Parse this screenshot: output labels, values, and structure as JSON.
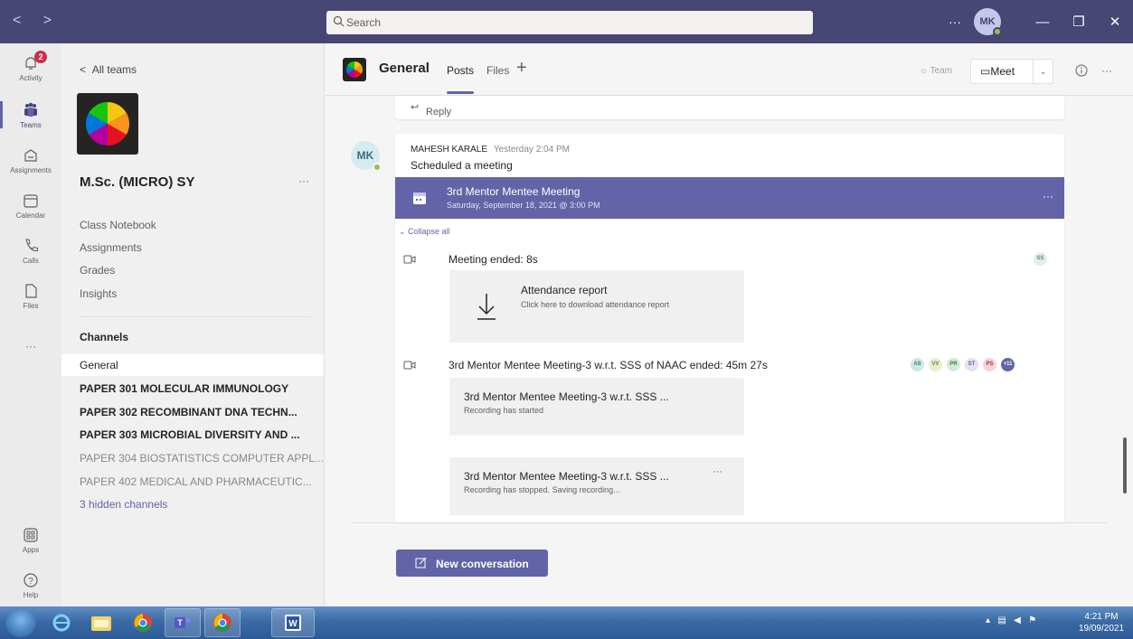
{
  "titlebar": {
    "nav_arrows": "< >",
    "search_placeholder": "Search",
    "more": "···",
    "avatar_initials": "MK"
  },
  "rail": {
    "items": [
      {
        "label": "Activity",
        "badge": "2"
      },
      {
        "label": "Teams"
      },
      {
        "label": "Assignments"
      },
      {
        "label": "Calendar"
      },
      {
        "label": "Calls"
      },
      {
        "label": "Files"
      },
      {
        "label": "···"
      },
      {
        "label": "Apps"
      },
      {
        "label": "Help"
      }
    ]
  },
  "left_panel": {
    "back_label": "All teams",
    "team_name": "M.Sc. (MICRO) SY",
    "team_more": "···",
    "links": [
      "Class Notebook",
      "Assignments",
      "Grades",
      "Insights"
    ],
    "channels_header": "Channels",
    "channels": [
      {
        "name": "General",
        "style": "selected"
      },
      {
        "name": "PAPER 301 MOLECULAR IMMUNOLOGY",
        "style": "bold"
      },
      {
        "name": "PAPER 302 RECOMBINANT DNA TECHN...",
        "style": "bold"
      },
      {
        "name": "PAPER 303 MICROBIAL DIVERSITY AND ...",
        "style": "bold"
      },
      {
        "name": "PAPER 304 BIOSTATISTICS COMPUTER APPL...",
        "style": "dim"
      },
      {
        "name": "PAPER 402 MEDICAL AND PHARMACEUTIC...",
        "style": "dim"
      },
      {
        "name": "3 hidden channels",
        "style": "link"
      }
    ]
  },
  "channel_header": {
    "title": "General",
    "tabs": [
      "Posts",
      "Files"
    ],
    "add_tab": "+",
    "team_button": "Team",
    "meet_button": "Meet",
    "more": "···"
  },
  "conversation": {
    "reply_label": "Reply",
    "author": "MAHESH KARALE",
    "time": "Yesterday 2:04 PM",
    "avatar": "MK",
    "text": "Scheduled a meeting",
    "meeting_title": "3rd Mentor Mentee Meeting",
    "meeting_date": "Saturday, September 18, 2021 @ 3:00 PM",
    "banner_more": "···",
    "collapse_label": "Collapse all",
    "event1": "Meeting ended: 8s",
    "event1_participant": "SS",
    "attendance_title": "Attendance report",
    "attendance_sub": "Click here to download attendance report",
    "event2": "3rd Mentor Mentee Meeting-3 w.r.t. SSS of NAAC ended: 45m 27s",
    "event2_participants": [
      {
        "initials": "AS",
        "bg": "#cfe8e4",
        "fg": "#3a7a70"
      },
      {
        "initials": "VV",
        "bg": "#e6f0cf",
        "fg": "#6a7f30"
      },
      {
        "initials": "PR",
        "bg": "#d5ebd8",
        "fg": "#3f7a4a"
      },
      {
        "initials": "ST",
        "bg": "#e6e0f0",
        "fg": "#6b5a8a"
      },
      {
        "initials": "PS",
        "bg": "#f4d4da",
        "fg": "#a3344a"
      },
      {
        "initials": "+11",
        "bg": "#6264a7",
        "fg": "#ffffff"
      }
    ],
    "rec1_title": "3rd Mentor Mentee Meeting-3 w.r.t. SSS ...",
    "rec1_sub": "Recording has started",
    "rec2_title": "3rd Mentor Mentee Meeting-3 w.r.t. SSS ...",
    "rec2_sub": "Recording has stopped. Saving recording...",
    "rec2_more": "···",
    "new_conversation": "New conversation"
  },
  "taskbar": {
    "time": "4:21 PM",
    "date": "19/09/2021"
  },
  "colors": {
    "accent": "#6264a7",
    "titlebar": "#464775",
    "badge": "#c4314b",
    "presence": "#92c353"
  }
}
